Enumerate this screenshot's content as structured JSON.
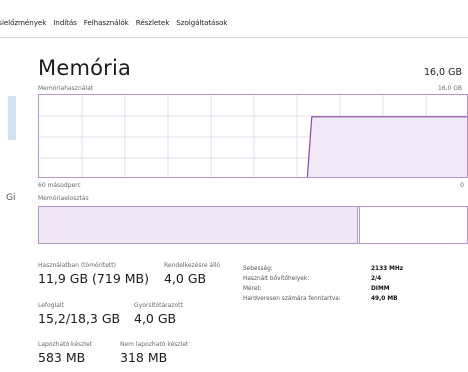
{
  "tabs": [
    "ásielőzmények",
    "Indítás",
    "Felhasználók",
    "Részletek",
    "Szolgáltatások"
  ],
  "memory": {
    "title": "Memória",
    "total": "16,0 GB",
    "usage_label": "Memóriahasználat",
    "usage_max": "16,0 GB",
    "time_label": "60 másodperc",
    "time_zero": "0",
    "composition_label": "Memóriaelosztás",
    "usage_series": [
      0,
      0,
      0,
      0,
      0,
      0,
      0,
      0,
      0,
      0,
      0,
      0,
      0,
      0,
      0,
      0,
      0,
      0,
      0,
      0,
      0,
      0,
      0,
      0,
      0,
      0,
      0,
      0,
      0,
      0,
      0,
      0,
      0,
      0,
      0,
      0,
      0,
      0,
      0,
      0,
      0,
      0,
      0,
      0,
      0,
      0,
      0,
      0,
      0,
      0,
      0,
      0,
      0,
      0,
      0,
      0,
      0,
      0,
      0,
      0.74,
      0.74,
      0.74,
      0.74,
      0.74,
      0.74,
      0.74,
      0.74,
      0.74,
      0.74,
      0.74,
      0.74,
      0.74,
      0.74,
      0.74,
      0.74,
      0.74,
      0.74,
      0.74,
      0.74,
      0.74,
      0.74,
      0.74,
      0.74,
      0.74,
      0.74,
      0.74,
      0.74,
      0.74,
      0.74,
      0.74,
      0.74,
      0.74,
      0.74,
      0.74
    ],
    "composition": {
      "in_use_fraction": 0.74,
      "modified_fraction": 0.005,
      "standby_fraction": 0.0,
      "free_fraction": 0.255
    }
  },
  "stats": {
    "in_use": {
      "label": "Használatban (tömörített)",
      "value": "11,9 GB (719 MB)"
    },
    "available": {
      "label": "Rendelkezésre álló",
      "value": "4,0 GB"
    },
    "committed": {
      "label": "Lefoglalt",
      "value": "15,2/18,3 GB"
    },
    "cached": {
      "label": "Gyorsítótárazott",
      "value": "4,0 GB"
    },
    "paged_pool": {
      "label": "Lapozható készlet",
      "value": "583 MB"
    },
    "nonpaged_pool": {
      "label": "Nem lapozható készlet",
      "value": "318 MB"
    }
  },
  "properties": [
    {
      "key": "Sebesség:",
      "value": "2133 MHz"
    },
    {
      "key": "Használt bővítőhelyek:",
      "value": "2/4"
    },
    {
      "key": "Méret:",
      "value": "DIMM"
    },
    {
      "key": "Hardveresen számára fenntartva:",
      "value": "49,0 MB"
    }
  ],
  "left": {
    "glyph": "Gi"
  },
  "colors": {
    "accent": "#8b4aa8",
    "graph_border": "#b597c7",
    "graph_grid": "#e6dcec",
    "graph_fill": "#f1e9f5",
    "selection": "#cfe3f5"
  }
}
